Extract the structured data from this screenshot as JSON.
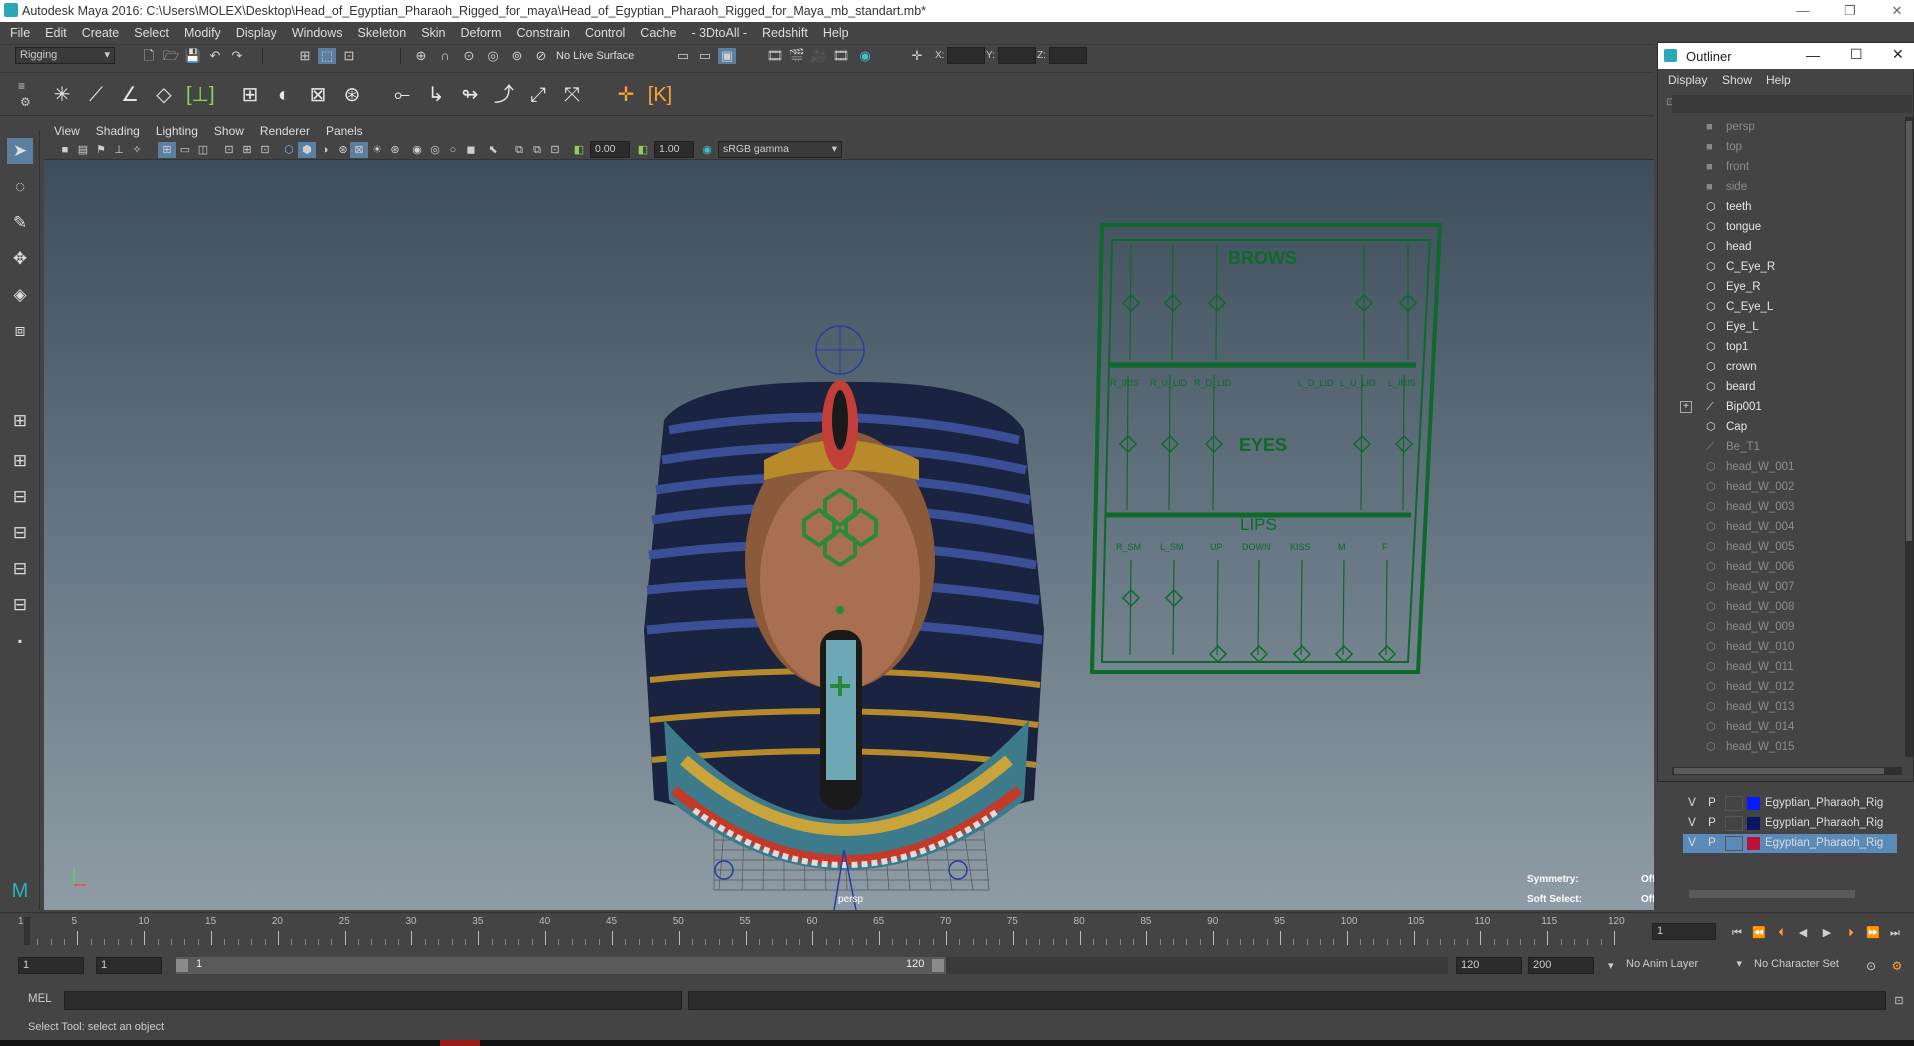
{
  "window": {
    "title": "Autodesk Maya 2016: C:\\Users\\MOLEX\\Desktop\\Head_of_Egyptian_Pharaoh_Rigged_for_maya\\Head_of_Egyptian_Pharaoh_Rigged_for_Maya_mb_standart.mb*",
    "minimize": "—",
    "restore": "❐",
    "close": "✕"
  },
  "menubar": [
    "File",
    "Edit",
    "Create",
    "Select",
    "Modify",
    "Display",
    "Windows",
    "Skeleton",
    "Skin",
    "Deform",
    "Constrain",
    "Control",
    "Cache",
    "- 3DtoAll -",
    "Redshift",
    "Help"
  ],
  "statusline": {
    "mode": "Rigging",
    "live_surface": "No Live Surface",
    "x_label": "X:",
    "y_label": "Y:",
    "z_label": "Z:"
  },
  "panel": {
    "menus": [
      "View",
      "Shading",
      "Lighting",
      "Show",
      "Renderer",
      "Panels"
    ],
    "exposure": "0.00",
    "gamma": "1.00",
    "color_space": "sRGB gamma"
  },
  "viewport": {
    "camera": "persp",
    "symmetry_label": "Symmetry:",
    "symmetry_value": "Off",
    "soft_select_label": "Soft Select:",
    "soft_select_value": "Off",
    "panel_labels": {
      "brows": "BROWS",
      "eyes": "EYES",
      "lips": "LIPS",
      "eye_ctrls": [
        "R_IRIS",
        "R_U_LID",
        "R_D_LID",
        "L_D_LID",
        "L_U_LID",
        "L_IRIS"
      ],
      "lip_ctrls": [
        "R_SM",
        "L_SM",
        "UP",
        "DOWN",
        "KISS",
        "M",
        "F"
      ]
    }
  },
  "outliner": {
    "title": "Outliner",
    "menus": [
      "Display",
      "Show",
      "Help"
    ],
    "items": [
      {
        "label": "persp",
        "type": "camera",
        "dim": true
      },
      {
        "label": "top",
        "type": "camera",
        "dim": true
      },
      {
        "label": "front",
        "type": "camera",
        "dim": true
      },
      {
        "label": "side",
        "type": "camera",
        "dim": true
      },
      {
        "label": "teeth",
        "type": "mesh",
        "dim": false
      },
      {
        "label": "tongue",
        "type": "mesh",
        "dim": false
      },
      {
        "label": "head",
        "type": "mesh",
        "dim": false
      },
      {
        "label": "C_Eye_R",
        "type": "mesh",
        "dim": false
      },
      {
        "label": "Eye_R",
        "type": "mesh",
        "dim": false
      },
      {
        "label": "C_Eye_L",
        "type": "mesh",
        "dim": false
      },
      {
        "label": "Eye_L",
        "type": "mesh",
        "dim": false
      },
      {
        "label": "top1",
        "type": "mesh",
        "dim": false
      },
      {
        "label": "crown",
        "type": "mesh",
        "dim": false
      },
      {
        "label": "beard",
        "type": "mesh",
        "dim": false
      },
      {
        "label": "Bip001",
        "type": "joint",
        "dim": false,
        "expand": "+"
      },
      {
        "label": "Cap",
        "type": "mesh",
        "dim": false
      },
      {
        "label": "Be_T1",
        "type": "joint",
        "dim": true
      },
      {
        "label": "head_W_001",
        "type": "mesh",
        "dim": true
      },
      {
        "label": "head_W_002",
        "type": "mesh",
        "dim": true
      },
      {
        "label": "head_W_003",
        "type": "mesh",
        "dim": true
      },
      {
        "label": "head_W_004",
        "type": "mesh",
        "dim": true
      },
      {
        "label": "head_W_005",
        "type": "mesh",
        "dim": true
      },
      {
        "label": "head_W_006",
        "type": "mesh",
        "dim": true
      },
      {
        "label": "head_W_007",
        "type": "mesh",
        "dim": true
      },
      {
        "label": "head_W_008",
        "type": "mesh",
        "dim": true
      },
      {
        "label": "head_W_009",
        "type": "mesh",
        "dim": true
      },
      {
        "label": "head_W_010",
        "type": "mesh",
        "dim": true
      },
      {
        "label": "head_W_011",
        "type": "mesh",
        "dim": true
      },
      {
        "label": "head_W_012",
        "type": "mesh",
        "dim": true
      },
      {
        "label": "head_W_013",
        "type": "mesh",
        "dim": true
      },
      {
        "label": "head_W_014",
        "type": "mesh",
        "dim": true
      },
      {
        "label": "head_W_015",
        "type": "mesh",
        "dim": true
      }
    ]
  },
  "layers": [
    {
      "v": "V",
      "p": "P",
      "name": "Egyptian_Pharaoh_Rig",
      "color": "#0a1aff",
      "selected": false
    },
    {
      "v": "V",
      "p": "P",
      "name": "Egyptian_Pharaoh_Rig",
      "color": "#0b1560",
      "selected": false
    },
    {
      "v": "V",
      "p": "P",
      "name": "Egyptian_Pharaoh_Rig",
      "color": "#c0103a",
      "selected": true
    }
  ],
  "timeline": {
    "ticks": [
      "1",
      "5",
      "10",
      "15",
      "20",
      "25",
      "30",
      "35",
      "40",
      "45",
      "50",
      "55",
      "60",
      "65",
      "70",
      "75",
      "80",
      "85",
      "90",
      "95",
      "100",
      "105",
      "110",
      "115",
      "120"
    ],
    "current_frame": "1"
  },
  "range": {
    "start": "1",
    "inner_start": "1",
    "slider_start": "1",
    "slider_end": "120",
    "end": "120",
    "outer_end": "200",
    "anim_layer": "No Anim Layer",
    "char_set": "No Character Set"
  },
  "cmdline": {
    "label": "MEL"
  },
  "help": "Select Tool: select an object"
}
